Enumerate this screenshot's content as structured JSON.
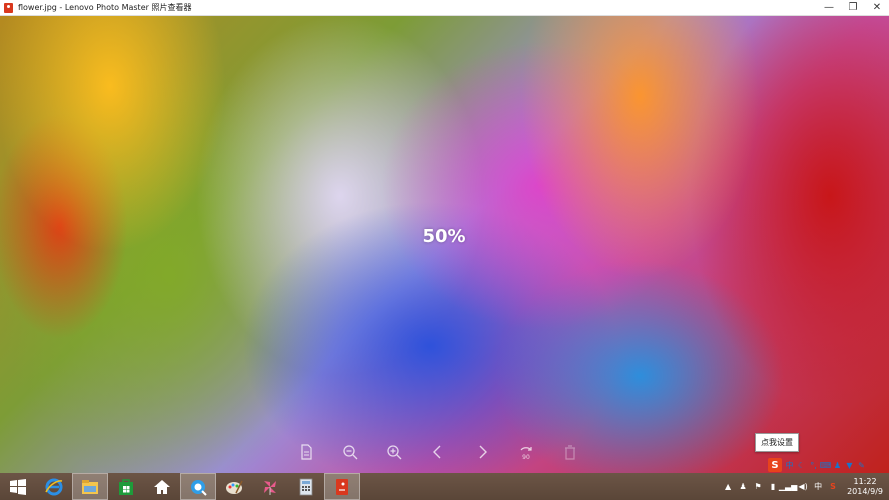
{
  "window": {
    "title": "flower.jpg - Lenovo Photo Master 照片查看器",
    "minimize_glyph": "—",
    "restore_glyph": "❐",
    "close_glyph": "✕"
  },
  "viewer": {
    "zoom_text": "50%",
    "rotate_label": "90",
    "toolbar_icons": [
      "file-info-icon",
      "zoom-out-icon",
      "zoom-in-icon",
      "previous-icon",
      "next-icon",
      "rotate-90-icon",
      "delete-icon"
    ]
  },
  "ime": {
    "tooltip": "点我设置",
    "logo_text": "S",
    "mode_text": "中"
  },
  "taskbar": {
    "apps": [
      "windows-start-icon",
      "internet-explorer-icon",
      "file-explorer-icon",
      "windows-store-icon",
      "home-icon",
      "browser-icon",
      "paint-icon",
      "pinwheel-app-icon",
      "calculator-icon",
      "photo-master-icon"
    ]
  },
  "tray": {
    "lang_text": "中",
    "time": "11:22",
    "date": "2014/9/9"
  },
  "colors": {
    "ime_brand": "#e8431c",
    "taskbar": "#5a4638"
  }
}
